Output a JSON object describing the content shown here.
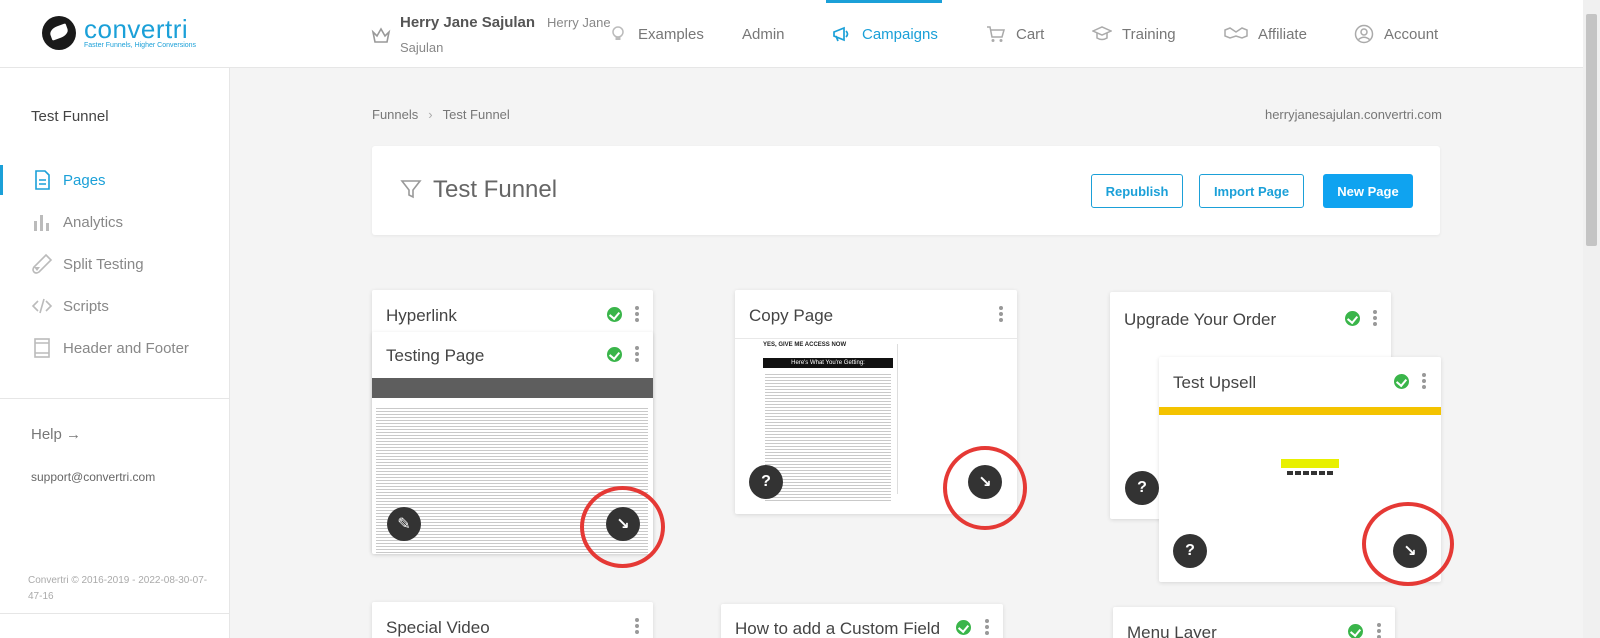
{
  "brand": {
    "name": "convertri",
    "tagline": "Faster Funnels, Higher Conversions",
    "accent": "#1ba0d8"
  },
  "user": {
    "name": "Herry Jane Sajulan",
    "sub_line1": "Herry Jane",
    "sub_line2": "Sajulan"
  },
  "nav": [
    {
      "label": "Examples",
      "icon": "lightbulb-icon"
    },
    {
      "label": "Admin",
      "icon": ""
    },
    {
      "label": "Campaigns",
      "icon": "megaphone-icon",
      "active": true
    },
    {
      "label": "Cart",
      "icon": "cart-icon"
    },
    {
      "label": "Training",
      "icon": "graduation-cap-icon"
    },
    {
      "label": "Affiliate",
      "icon": "handshake-icon"
    },
    {
      "label": "Account",
      "icon": "user-circle-icon"
    }
  ],
  "sidebar": {
    "title": "Test Funnel",
    "items": [
      {
        "label": "Pages",
        "icon": "page-icon",
        "active": true
      },
      {
        "label": "Analytics",
        "icon": "bar-chart-icon"
      },
      {
        "label": "Split Testing",
        "icon": "flask-icon"
      },
      {
        "label": "Scripts",
        "icon": "code-icon"
      },
      {
        "label": "Header and Footer",
        "icon": "layout-icon"
      }
    ],
    "help": "Help →",
    "support": "support@convertri.com",
    "copyright": "Convertri © 2016-2019 - 2022-08-30-07-47-16"
  },
  "breadcrumb": {
    "root": "Funnels",
    "current": "Test Funnel"
  },
  "domain": "herryjanesajulan.convertri.com",
  "funnel": {
    "title": "Test Funnel",
    "buttons": {
      "republish": "Republish",
      "import": "Import Page",
      "new_page": "New Page"
    }
  },
  "cards": {
    "hyperlink": "Hyperlink",
    "testing_page": "Testing Page",
    "copy_page": "Copy Page",
    "upgrade_order": "Upgrade Your Order",
    "test_upsell": "Test Upsell",
    "special_video": "Special Video",
    "custom_field": "How to add a Custom Field",
    "menu_layer": "Menu Layer"
  },
  "thumb_text": {
    "copy_headline": "YES, GIVE ME ACCESS NOW",
    "copy_bar": "Here's What You're Getting:",
    "upsell_link": "Select Close This Page!"
  },
  "glyphs": {
    "question": "?",
    "pencil": "✎",
    "arrow": "↘",
    "chevron": "›"
  }
}
